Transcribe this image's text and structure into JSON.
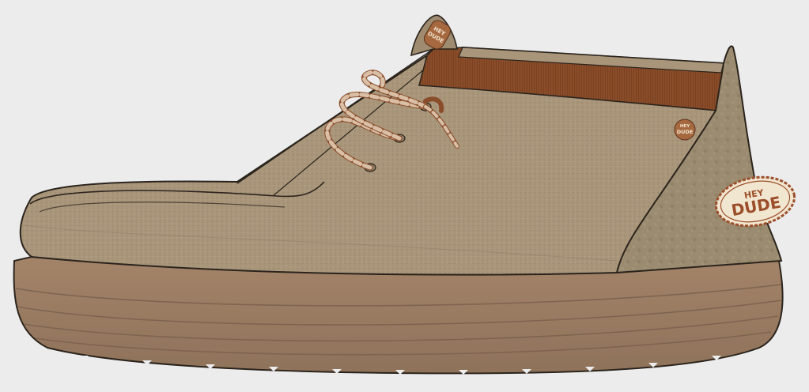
{
  "background_color": "#ececec",
  "product": {
    "brand_badge_heel": {
      "line1": "HEY",
      "line2": "DUDE"
    },
    "brand_badge_collar": {
      "line1": "HEY",
      "line2": "DUDE"
    },
    "brand_badge_tongue": {
      "line1": "HEY",
      "line2": "DUDE"
    }
  },
  "colors": {
    "canvas_upper": "#a8957a",
    "canvas_shadow": "#8e7c63",
    "heel_suede": "#9a8a70",
    "collar_band": "#8a4d2a",
    "sole": "#9b7d63",
    "sole_dark": "#7f6450",
    "lace": "#c9a78a",
    "lace_stripe": "#8a4d2a",
    "outline": "#2b241c",
    "badge_fill": "#f1e6d0",
    "badge_text": "#9c4e2a"
  }
}
